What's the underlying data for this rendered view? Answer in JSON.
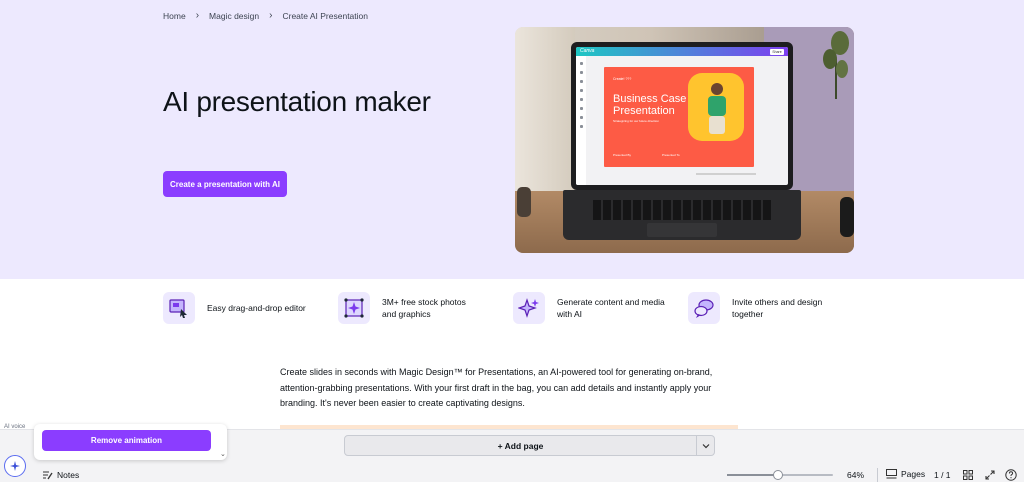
{
  "breadcrumb": {
    "items": [
      "Home",
      "Magic design",
      "Create AI Presentation"
    ]
  },
  "hero": {
    "title": "AI presentation maker",
    "cta_label": "Create a presentation with AI"
  },
  "hero_image": {
    "app_logo": "Canva",
    "share_label": "Share",
    "slide_kicker": "Create! ???",
    "slide_title": "Business Case Presentation",
    "slide_subtitle": "Strategizing for our future direction",
    "slide_meta_left": "Presented By",
    "slide_meta_right": "Presented To"
  },
  "features": [
    {
      "icon": "drag-drop-editor-icon",
      "label": "Easy drag-and-drop editor"
    },
    {
      "icon": "stock-photos-icon",
      "label": "3M+ free stock photos and graphics"
    },
    {
      "icon": "sparkles-icon",
      "label": "Generate content and media with AI"
    },
    {
      "icon": "chat-bubbles-icon",
      "label": "Invite others and design together"
    }
  ],
  "description": "Create slides in seconds with Magic Design™ for Presentations, an AI-powered tool for generating on-brand, attention-grabbing presentations. With your first draft in the bag, you can add details and instantly apply your branding. It's never been easier to create captivating designs.",
  "editor": {
    "anim_hint": "AI voice",
    "remove_animation_label": "Remove animation",
    "add_page_label": "+ Add page",
    "notes_label": "Notes",
    "zoom_level": "64%",
    "zoom_fraction": 0.48,
    "pages_label": "Pages",
    "page_count": "1 / 1"
  },
  "colors": {
    "accent": "#8b3dff",
    "hero_bg": "#ede9fe",
    "slide_red": "#fd5b45"
  }
}
